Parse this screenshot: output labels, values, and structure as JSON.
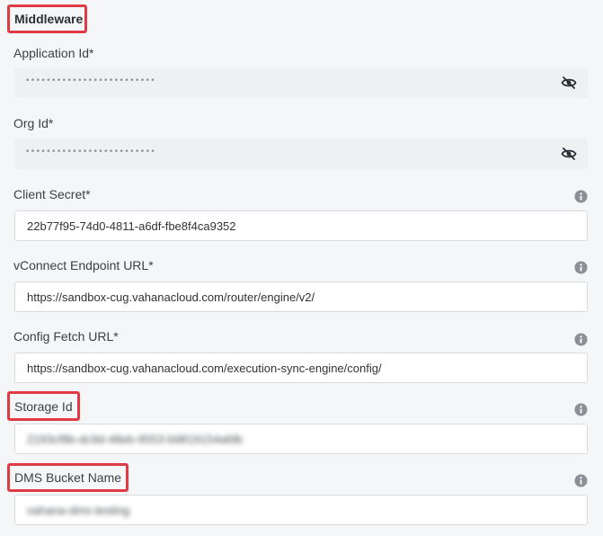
{
  "section": {
    "title": "Middleware"
  },
  "fields": {
    "application_id": {
      "label": "Application Id*",
      "masked_value": "•••••••••••••••••••••••••",
      "toggle_icon": "eye-slash-icon"
    },
    "org_id": {
      "label": "Org Id*",
      "masked_value": "•••••••••••••••••••••••••",
      "toggle_icon": "eye-slash-icon"
    },
    "client_secret": {
      "label": "Client Secret*",
      "value": "22b77f95-74d0-4811-a6df-fbe8f4ca9352",
      "info_icon": "info-icon"
    },
    "vconnect_endpoint": {
      "label": "vConnect Endpoint URL*",
      "value": "https://sandbox-cug.vahanacloud.com/router/engine/v2/",
      "info_icon": "info-icon"
    },
    "config_fetch": {
      "label": "Config Fetch URL*",
      "value": "https://sandbox-cug.vahanacloud.com/execution-sync-engine/config/",
      "info_icon": "info-icon"
    },
    "storage_id": {
      "label": "Storage Id",
      "value": "2193cf8b-dc9d-48eb-9553-b9819154afdb",
      "info_icon": "info-icon"
    },
    "dms_bucket": {
      "label": "DMS Bucket Name",
      "value": "vahana-dms-testing",
      "info_icon": "info-icon"
    }
  },
  "colors": {
    "highlight_border": "#e03a45",
    "page_background": "#f5f6f7",
    "masked_field_background": "#eef0f2",
    "info_icon": "#8c9096"
  }
}
